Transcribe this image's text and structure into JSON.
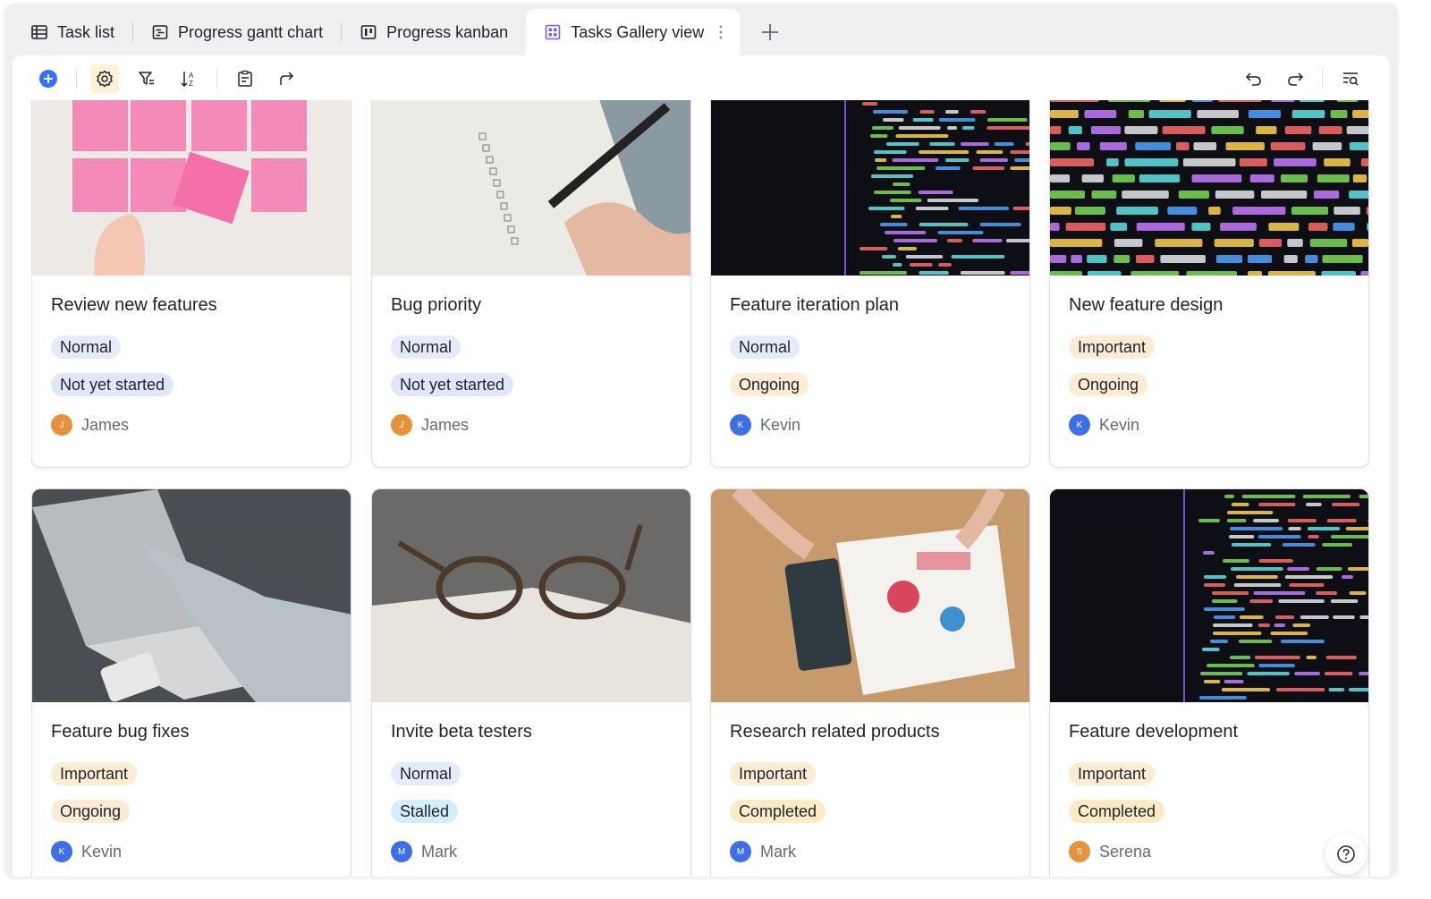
{
  "tabs": [
    {
      "label": "Task list",
      "icon": "table-icon",
      "active": false
    },
    {
      "label": "Progress gantt chart",
      "icon": "gantt-icon",
      "active": false
    },
    {
      "label": "Progress kanban",
      "icon": "kanban-icon",
      "active": false
    },
    {
      "label": "Tasks Gallery view",
      "icon": "gallery-icon",
      "active": true
    }
  ],
  "colors": {
    "accent": "#3370ff",
    "tag_normal": "#e6ebfa",
    "tag_important": "#fdecd4",
    "tag_not_started": "#e1e7fb",
    "tag_ongoing": "#fdecd4",
    "tag_stalled": "#d3eef9",
    "tag_completed": "#fbecc5",
    "avatar_james": "#e8913b",
    "avatar_kevin": "#3c6fe8",
    "avatar_mark": "#3c6fe8",
    "avatar_serena": "#e8913b"
  },
  "cards": [
    {
      "title": "Review new features",
      "priority": "Normal",
      "status": "Not yet started",
      "assignee": "James",
      "initial": "J",
      "image": "sticky-notes"
    },
    {
      "title": "Bug priority",
      "priority": "Normal",
      "status": "Not yet started",
      "assignee": "James",
      "initial": "J",
      "image": "notebook-checklist"
    },
    {
      "title": "Feature iteration plan",
      "priority": "Normal",
      "status": "Ongoing",
      "assignee": "Kevin",
      "initial": "K",
      "image": "code-screen"
    },
    {
      "title": "New feature design",
      "priority": "Important",
      "status": "Ongoing",
      "assignee": "Kevin",
      "initial": "K",
      "image": "code-closeup"
    },
    {
      "title": "Feature bug fixes",
      "priority": "Important",
      "status": "Ongoing",
      "assignee": "Kevin",
      "initial": "K",
      "image": "laptop-typing"
    },
    {
      "title": "Invite beta testers",
      "priority": "Normal",
      "status": "Stalled",
      "assignee": "Mark",
      "initial": "M",
      "image": "glasses-notebook"
    },
    {
      "title": "Research related products",
      "priority": "Important",
      "status": "Completed",
      "assignee": "Mark",
      "initial": "M",
      "image": "charts-tablet"
    },
    {
      "title": "Feature development",
      "priority": "Important",
      "status": "Completed",
      "assignee": "Serena",
      "initial": "S",
      "image": "code-screen"
    }
  ],
  "toolbar": {
    "left": [
      "add-record",
      "view-settings",
      "filter",
      "sort",
      "form",
      "share"
    ],
    "right": [
      "undo",
      "redo",
      "search"
    ]
  }
}
